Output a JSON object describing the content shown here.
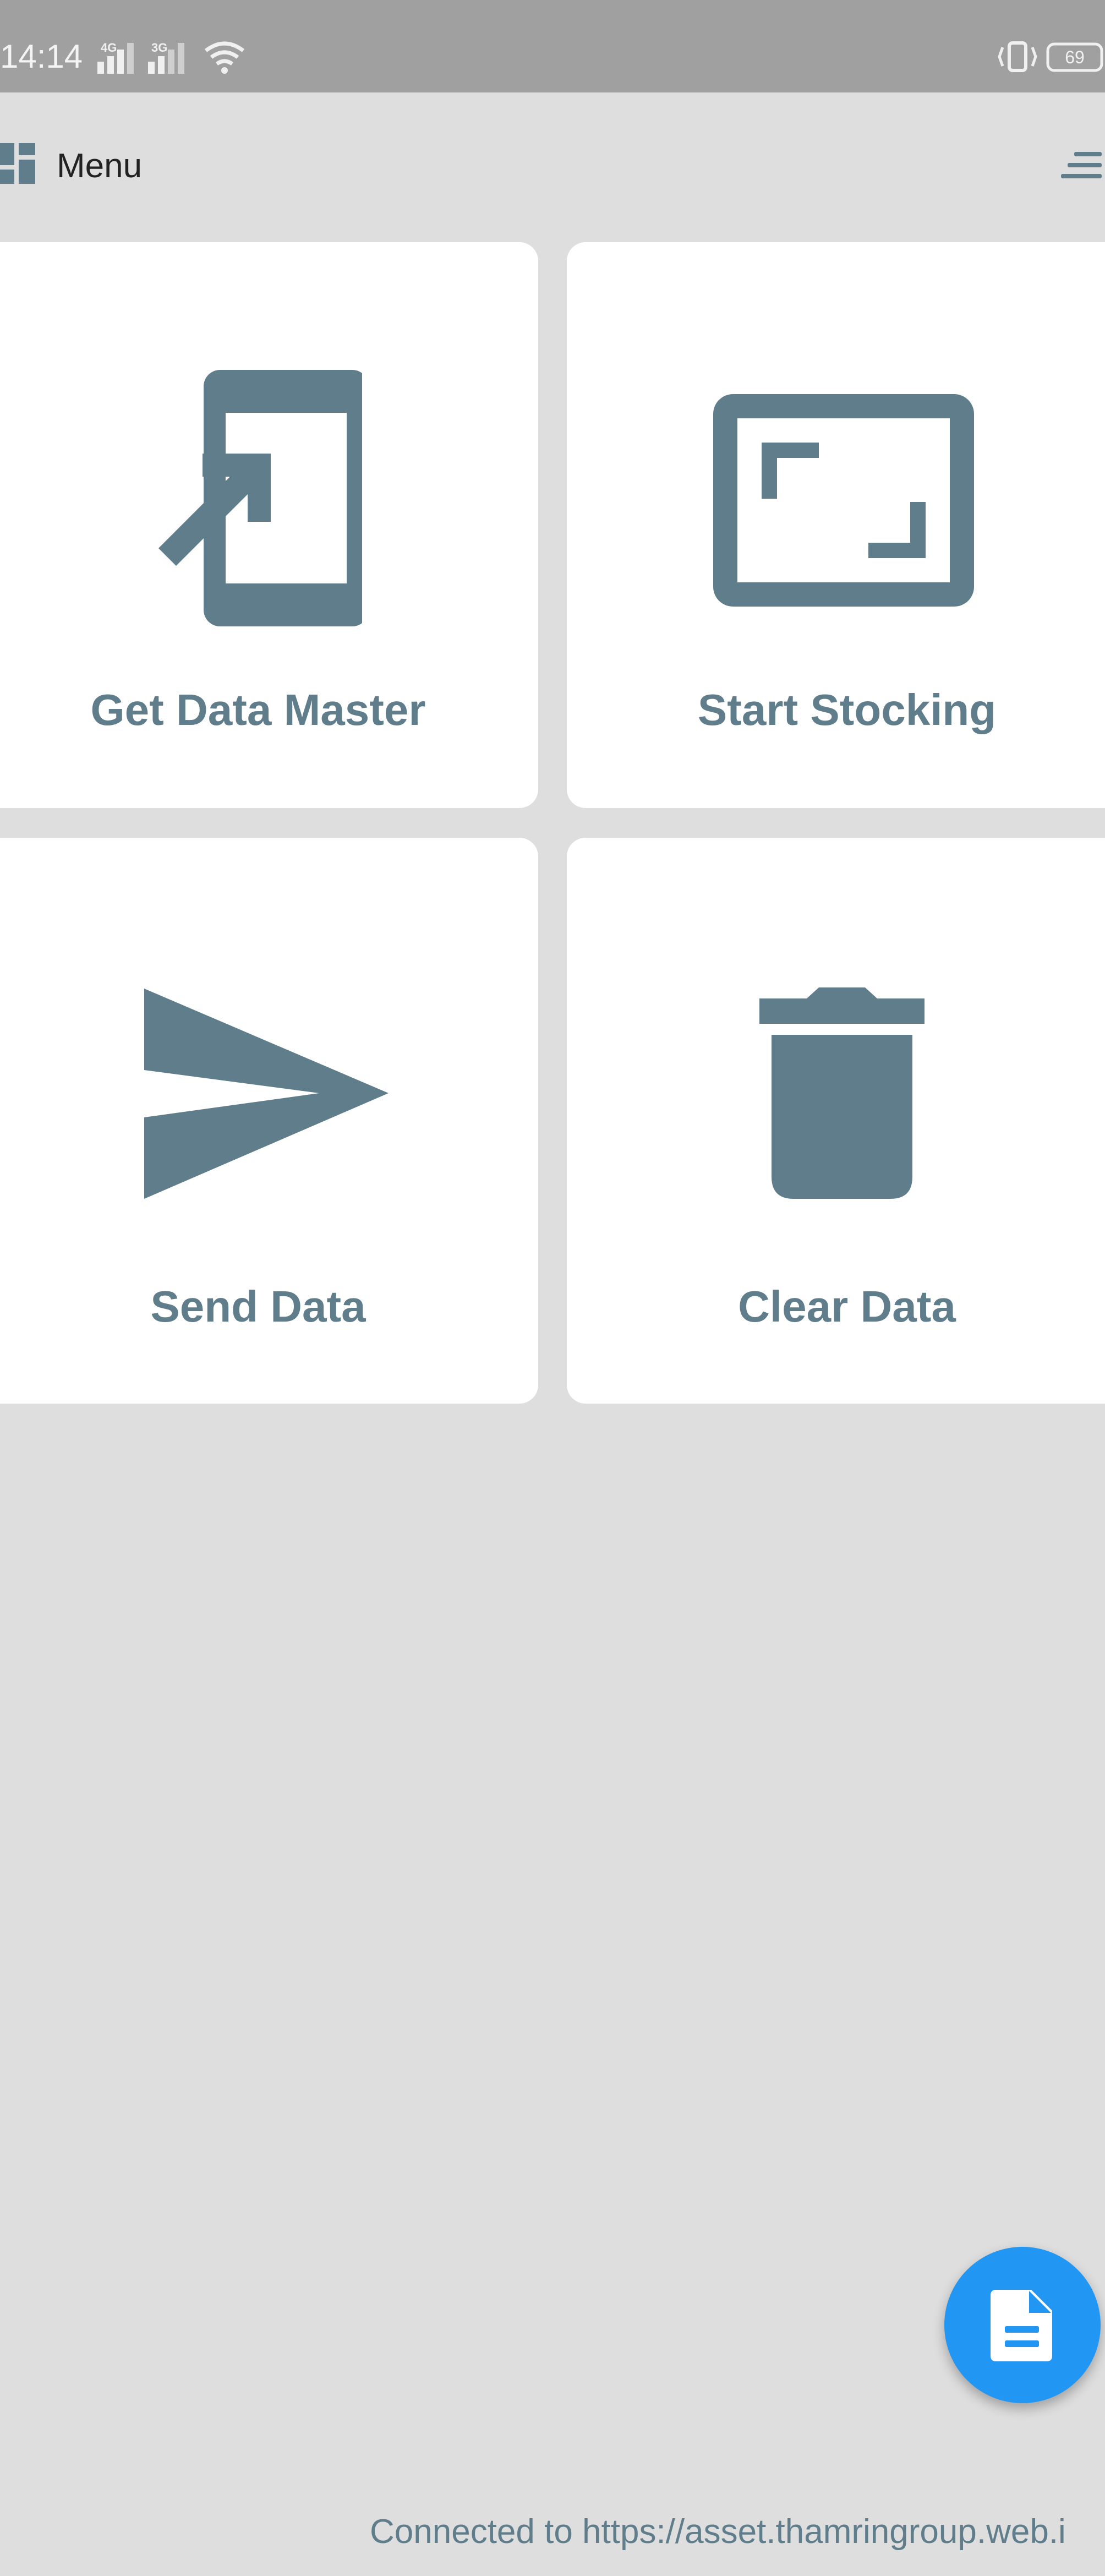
{
  "status_bar": {
    "time": "14:14",
    "net_4g": "4G",
    "net_3g": "3G",
    "battery": "69",
    "icons": [
      "signal-4g-icon",
      "signal-3g-icon",
      "wifi-icon",
      "vibrate-icon",
      "battery-icon"
    ]
  },
  "header": {
    "menu_label": "Menu",
    "icons": [
      "dashboard-icon",
      "menu-toggle-icon"
    ]
  },
  "cards": [
    {
      "label": "Get Data Master",
      "icon": "import-phone-icon"
    },
    {
      "label": "Start Stocking",
      "icon": "scan-frame-icon"
    },
    {
      "label": "Send Data",
      "icon": "send-icon"
    },
    {
      "label": "Clear Data",
      "icon": "trash-icon"
    }
  ],
  "fab": {
    "icon": "document-icon",
    "color": "#2196f3"
  },
  "footer": {
    "connection_text": "Connected to https://asset.thamringroup.web.i"
  },
  "colors": {
    "icon_accent": "#607d8b",
    "background": "#dedede",
    "status_bar": "#a0a0a0"
  }
}
